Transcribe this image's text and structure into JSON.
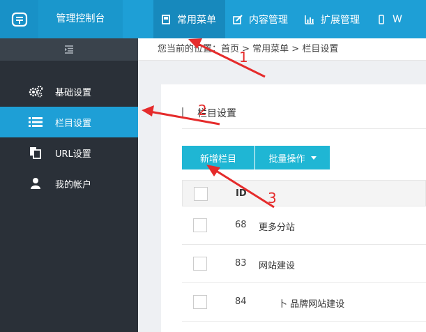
{
  "header": {
    "console_title": "管理控制台",
    "nav": [
      {
        "label": "常用菜单",
        "icon": "bookmark-icon",
        "active": true
      },
      {
        "label": "内容管理",
        "icon": "edit-icon",
        "active": false
      },
      {
        "label": "扩展管理",
        "icon": "bar-chart-icon",
        "active": false
      },
      {
        "label": "W",
        "icon": "mobile-icon",
        "active": false
      }
    ]
  },
  "sidebar": {
    "items": [
      {
        "label": "基础设置",
        "icon": "gears-icon",
        "active": false
      },
      {
        "label": "栏目设置",
        "icon": "list-icon",
        "active": true
      },
      {
        "label": "URL设置",
        "icon": "copy-icon",
        "active": false
      },
      {
        "label": "我的帐户",
        "icon": "user-icon",
        "active": false
      }
    ]
  },
  "breadcrumb": {
    "text": "您当前的位置：首页 > 常用菜单 > 栏目设置"
  },
  "panel": {
    "title": "栏目设置",
    "add_button": "新增栏目",
    "batch_button": "批量操作"
  },
  "table": {
    "header_id": "ID",
    "rows": [
      {
        "id": "68",
        "name": "更多分站"
      },
      {
        "id": "83",
        "name": "网站建设"
      },
      {
        "id": "84",
        "name": "卜 品牌网站建设"
      }
    ]
  },
  "annotations": {
    "labels": [
      "1",
      "2",
      "3"
    ],
    "color": "#e52b2b"
  }
}
